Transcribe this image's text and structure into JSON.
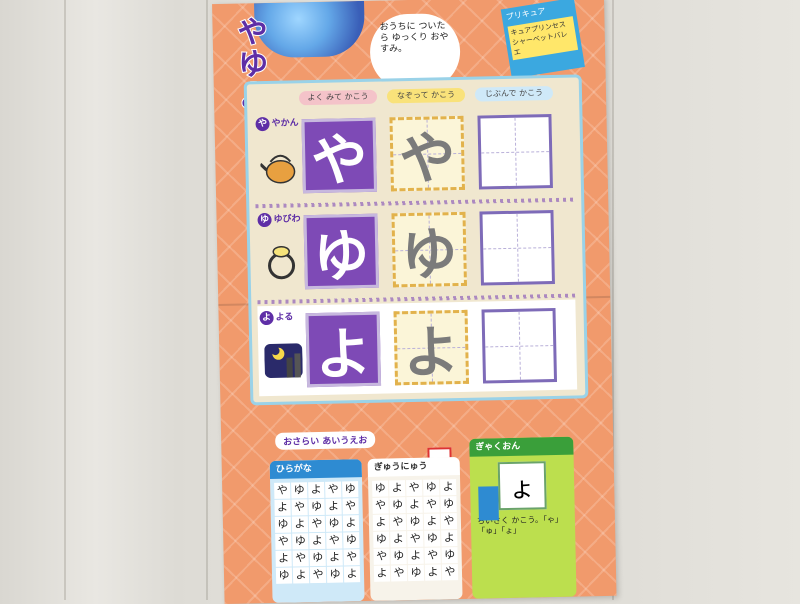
{
  "header": {
    "title_chars": [
      "や",
      "ゆ",
      "よ"
    ],
    "bubble_text": "おうちに ついたら ゆっくり おやすみ。",
    "promo_title": "プリキュア",
    "promo_sub": "キュアプリンセス シャーベットバレエ"
  },
  "columns": [
    "よく みて かこう",
    "なぞって かこう",
    "じぶんで かこう"
  ],
  "rows": [
    {
      "dot": "や",
      "label": "やかん",
      "glyph": "や",
      "picture": "kettle-icon"
    },
    {
      "dot": "ゆ",
      "label": "ゆびわ",
      "glyph": "ゆ",
      "picture": "ring-icon"
    },
    {
      "dot": "よ",
      "label": "よる",
      "glyph": "よ",
      "picture": "night-city-icon"
    }
  ],
  "bottom": {
    "section_label": "おさらい あいうえお",
    "panel1_title": "ひらがな",
    "panel1_chars": [
      "や",
      "ゆ",
      "よ",
      "や",
      "ゆ",
      "よ",
      "や",
      "ゆ",
      "よ",
      "や",
      "ゆ",
      "よ",
      "や",
      "ゆ",
      "よ",
      "や",
      "ゆ",
      "よ",
      "や",
      "ゆ",
      "よ",
      "や",
      "ゆ",
      "よ",
      "や",
      "ゆ",
      "よ",
      "や",
      "ゆ",
      "よ"
    ],
    "panel2_title": "ぎゅうにゅう",
    "panel2_chars": [
      "ゆ",
      "よ",
      "や",
      "ゆ",
      "よ",
      "や",
      "ゆ",
      "よ",
      "や",
      "ゆ",
      "よ",
      "や",
      "ゆ",
      "よ",
      "や",
      "ゆ",
      "よ",
      "や",
      "ゆ",
      "よ",
      "や",
      "ゆ",
      "よ",
      "や",
      "ゆ",
      "よ",
      "や",
      "ゆ",
      "よ",
      "や"
    ],
    "panel3_title": "ぎゃくおん",
    "panel3_box_char": "ょ",
    "panel3_text": "ちいさく かこう。「ゃ」「ゅ」「ょ」"
  },
  "colors": {
    "purple": "#7e4ab6",
    "orange": "#f19a6c",
    "blue": "#2e8bd2",
    "green": "#bcdf4e"
  }
}
